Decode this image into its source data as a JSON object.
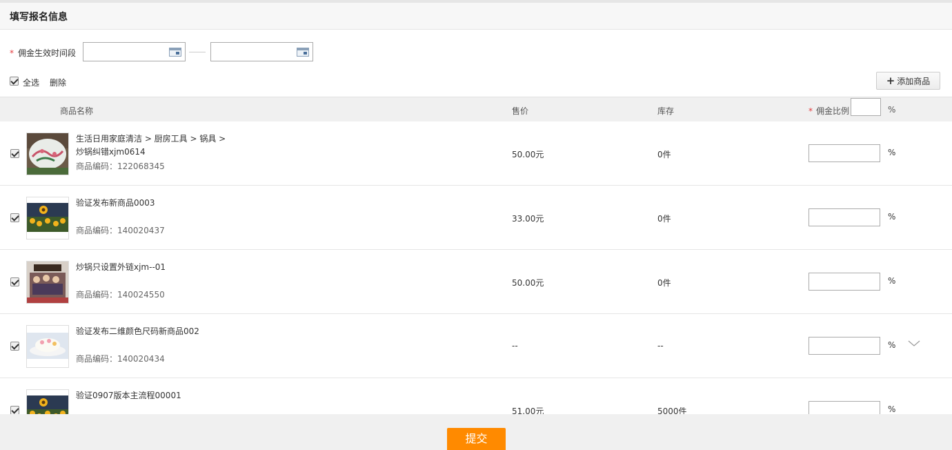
{
  "header": {
    "title": "填写报名信息"
  },
  "period": {
    "required_mark": "*",
    "label": "佣金生效时间段",
    "start_value": "",
    "end_value": ""
  },
  "toolbar": {
    "select_all_label": "全选",
    "delete_label": "删除",
    "add_button_label": "添加商品",
    "add_icon": "plus-icon"
  },
  "table": {
    "headers": {
      "name": "商品名称",
      "price": "售价",
      "stock": "库存",
      "ratio": "佣金比例",
      "ratio_required_mark": "*",
      "pct": "%"
    },
    "rows": [
      {
        "name": "生活日用家庭清洁 > 厨房工具 > 锅具 > 炒锅纠错xjm0614",
        "code": "商品编码：122068345",
        "price": "50.00元",
        "stock": "0件",
        "ratio": "",
        "pct": "%",
        "checked": true
      },
      {
        "name": "验证发布新商品0003",
        "code": "商品编码：140020437",
        "price": "33.00元",
        "stock": "0件",
        "ratio": "",
        "pct": "%",
        "checked": true
      },
      {
        "name": "炒锅只设置外链xjm--01",
        "code": "商品编码：140024550",
        "price": "50.00元",
        "stock": "0件",
        "ratio": "",
        "pct": "%",
        "checked": true
      },
      {
        "name": "验证发布二维颜色尺码新商品002",
        "code": "商品编码：140020434",
        "price": "--",
        "stock": "--",
        "ratio": "",
        "pct": "%",
        "checked": true
      },
      {
        "name": "验证0907版本主流程00001",
        "code": "",
        "price": "51.00元",
        "stock": "5000件",
        "ratio": "",
        "pct": "%",
        "checked": true
      }
    ]
  },
  "footer": {
    "submit_label": "提交"
  },
  "colors": {
    "accent": "#ff8a00",
    "required": "#e4393c"
  }
}
